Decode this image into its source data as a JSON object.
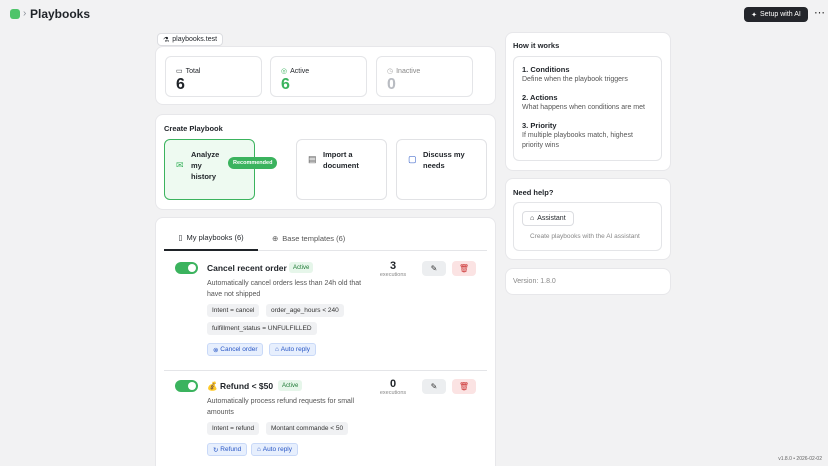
{
  "header": {
    "crumb_sep": "›",
    "title": "Playbooks",
    "setup_label": "Setup with AI",
    "more_label": "⋯"
  },
  "domain": "playbooks.test",
  "stats": [
    {
      "label": "Total",
      "value": "6",
      "color": "#1f2328"
    },
    {
      "label": "Active",
      "value": "6",
      "color": "#3bb35e"
    },
    {
      "label": "Inactive",
      "value": "0",
      "color": "#b9bcc2"
    }
  ],
  "create": {
    "title": "Create Playbook",
    "options": [
      {
        "label": "Analyze my history",
        "badge": "Recommended"
      },
      {
        "label": "Import a document"
      },
      {
        "label": "Discuss my needs"
      }
    ]
  },
  "tabs": [
    {
      "label": "My playbooks (6)"
    },
    {
      "label": "Base templates (6)"
    }
  ],
  "playbooks": [
    {
      "name": "Cancel recent order",
      "status": "Active",
      "count": "3",
      "count_label": "executions",
      "description": "Automatically cancel orders less than 24h old that have not shipped",
      "conditions": [
        "Intent = cancel",
        "order_age_hours < 240",
        "fulfillment_status = UNFULFILLED"
      ],
      "actions": [
        "Cancel order",
        "Auto reply"
      ]
    },
    {
      "name": "💰 Refund < $50",
      "status": "Active",
      "count": "0",
      "count_label": "executions",
      "description": "Automatically process refund requests for small amounts",
      "conditions": [
        "Intent = refund",
        "Montant commande < 50"
      ],
      "actions": [
        "Refund",
        "Auto reply"
      ]
    }
  ],
  "how": {
    "title": "How it works",
    "steps": [
      {
        "title": "1. Conditions",
        "text": "Define when the playbook triggers"
      },
      {
        "title": "2. Actions",
        "text": "What happens when conditions are met"
      },
      {
        "title": "3. Priority",
        "text": "If multiple playbooks match, highest priority wins"
      }
    ]
  },
  "help": {
    "title": "Need help?",
    "button": "Assistant",
    "text": "Create playbooks with the AI assistant"
  },
  "version": "Version: 1.8.0",
  "footer": "v1.8.0 • 2026-02-02"
}
